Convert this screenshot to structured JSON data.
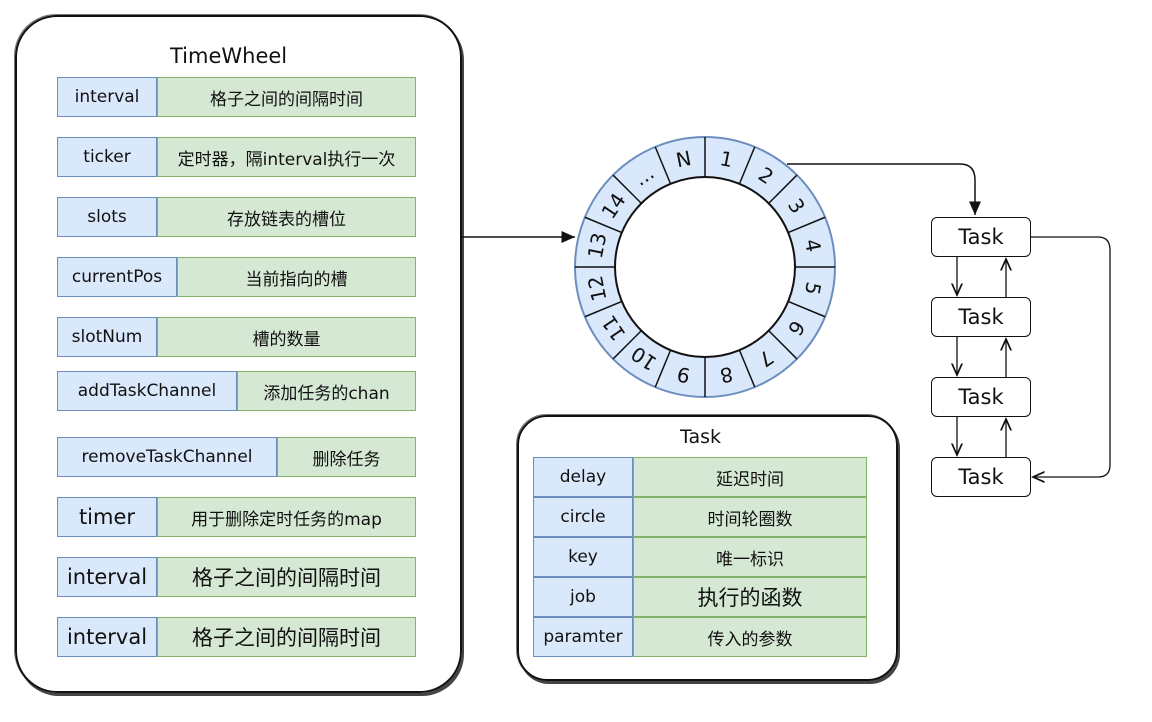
{
  "timewheel": {
    "title": "TimeWheel",
    "rows": [
      {
        "key": "interval",
        "value": "格子之间的间隔时间"
      },
      {
        "key": "ticker",
        "value": "定时器，隔interval执行一次"
      },
      {
        "key": "slots",
        "value": "存放链表的槽位"
      },
      {
        "key": "currentPos",
        "value": "当前指向的槽"
      },
      {
        "key": "slotNum",
        "value": "槽的数量"
      },
      {
        "key": "addTaskChannel",
        "value": "添加任务的chan"
      },
      {
        "key": "removeTaskChannel",
        "value": "删除任务"
      },
      {
        "key": "timer",
        "value": "用于删除定时任务的map"
      },
      {
        "key": "interval",
        "value": "格子之间的间隔时间"
      },
      {
        "key": "interval",
        "value": "格子之间的间隔时间"
      }
    ]
  },
  "wheel": {
    "slots": [
      "1",
      "2",
      "3",
      "4",
      "5",
      "6",
      "7",
      "8",
      "9",
      "10",
      "11",
      "12",
      "13",
      "14",
      "...",
      "N"
    ]
  },
  "task": {
    "title": "Task",
    "rows": [
      {
        "key": "delay",
        "value": "延迟时间"
      },
      {
        "key": "circle",
        "value": "时间轮圈数"
      },
      {
        "key": "key",
        "value": "唯一标识"
      },
      {
        "key": "job",
        "value": "执行的函数"
      },
      {
        "key": "paramter",
        "value": "传入的参数"
      }
    ]
  },
  "task_list": [
    "Task",
    "Task",
    "Task",
    "Task"
  ],
  "colors": {
    "key_fill": "#dae8fc",
    "key_border": "#6c8ebf",
    "value_fill": "#d5e8d4",
    "value_border": "#82b366"
  }
}
